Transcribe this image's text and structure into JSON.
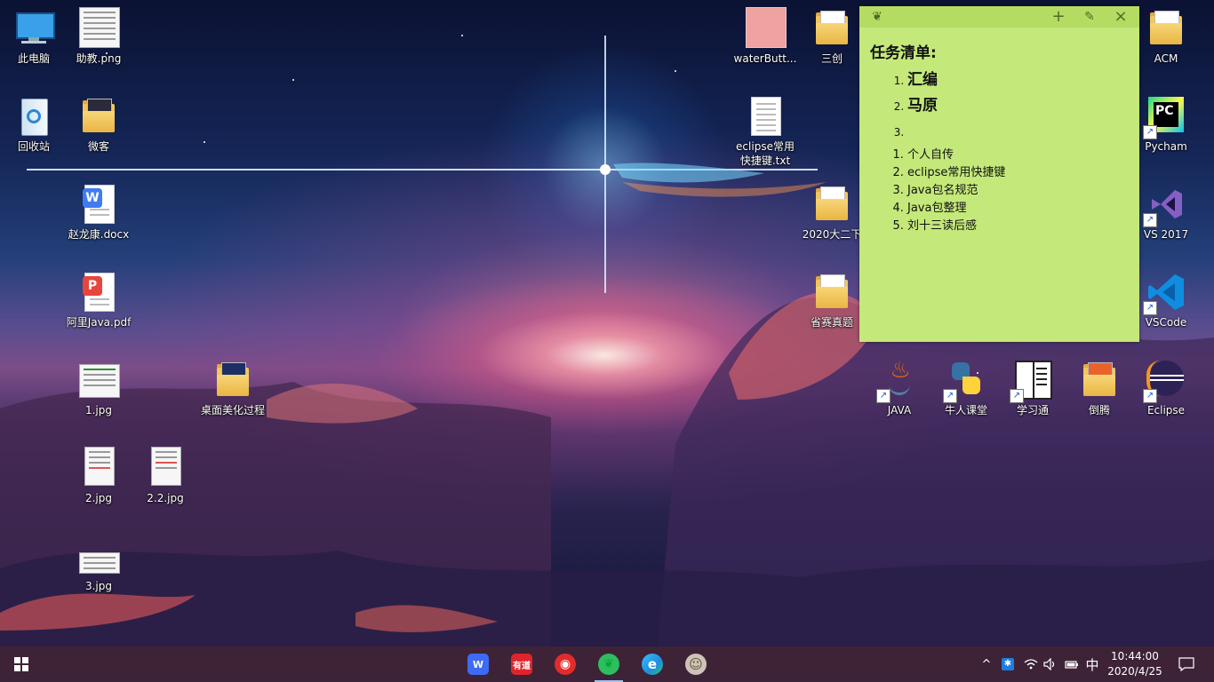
{
  "desktop": {
    "icons": [
      {
        "label": "此电脑",
        "icon": "computer-icon"
      },
      {
        "label": "助教.png",
        "icon": "image-file-icon"
      },
      {
        "label": "回收站",
        "icon": "recycle-bin-icon"
      },
      {
        "label": "微客",
        "icon": "folder-icon"
      },
      {
        "label": "赵龙康.docx",
        "icon": "word-doc-icon"
      },
      {
        "label": "阿里Java.pdf",
        "icon": "pdf-icon"
      },
      {
        "label": "1.jpg",
        "icon": "image-file-icon"
      },
      {
        "label": "桌面美化过程",
        "icon": "folder-icon"
      },
      {
        "label": "2.jpg",
        "icon": "image-file-icon"
      },
      {
        "label": "2.2.jpg",
        "icon": "image-file-icon"
      },
      {
        "label": "3.jpg",
        "icon": "image-file-icon"
      },
      {
        "label": "waterButt...",
        "icon": "image-file-icon"
      },
      {
        "label": "三创",
        "icon": "folder-icon"
      },
      {
        "label": "eclipse常用快捷键.txt",
        "icon": "text-file-icon"
      },
      {
        "label": "2020大二下",
        "icon": "folder-icon"
      },
      {
        "label": "省赛真题",
        "icon": "folder-icon"
      },
      {
        "label": "ACM",
        "icon": "folder-icon"
      },
      {
        "label": "Pycham",
        "icon": "pycharm-icon"
      },
      {
        "label": "VS 2017",
        "icon": "visual-studio-icon"
      },
      {
        "label": "VSCode",
        "icon": "vscode-icon"
      },
      {
        "label": "JAVA",
        "icon": "java-icon"
      },
      {
        "label": "牛人课堂",
        "icon": "python-icon"
      },
      {
        "label": "学习通",
        "icon": "xuexitong-icon"
      },
      {
        "label": "倒腾",
        "icon": "folder-icon"
      },
      {
        "label": "Eclipse",
        "icon": "eclipse-icon"
      }
    ]
  },
  "sticky_note": {
    "app_icon": "evernote-icon",
    "heading": "任务清单:",
    "main_list": [
      "汇编",
      "马原",
      ""
    ],
    "sub_list": [
      "个人自传",
      "eclipse常用快捷键",
      "Java包名规范",
      "Java包整理",
      "刘十三读后感"
    ],
    "buttons": {
      "add": "+",
      "pin": "pin-icon",
      "close": "×"
    }
  },
  "taskbar": {
    "start_icon": "windows-start-icon",
    "apps": [
      {
        "name": "wps-icon",
        "glyph": "W",
        "color": "#3d6bf5"
      },
      {
        "name": "youdao-icon",
        "glyph": "有道",
        "color": "#e0242b"
      },
      {
        "name": "netease-music-icon",
        "glyph": "◉",
        "color": "#e22b2b"
      },
      {
        "name": "evernote-icon",
        "glyph": "❦",
        "color": "#2dbe60"
      },
      {
        "name": "edge-icon",
        "glyph": "e",
        "color": "#1f8ce0"
      },
      {
        "name": "avatar-app-icon",
        "glyph": "☺",
        "color": "#cfc2b8"
      }
    ],
    "tray": {
      "chevron": "^",
      "input_method": "中"
    },
    "clock": {
      "time": "10:44:00",
      "date": "2020/4/25"
    }
  }
}
